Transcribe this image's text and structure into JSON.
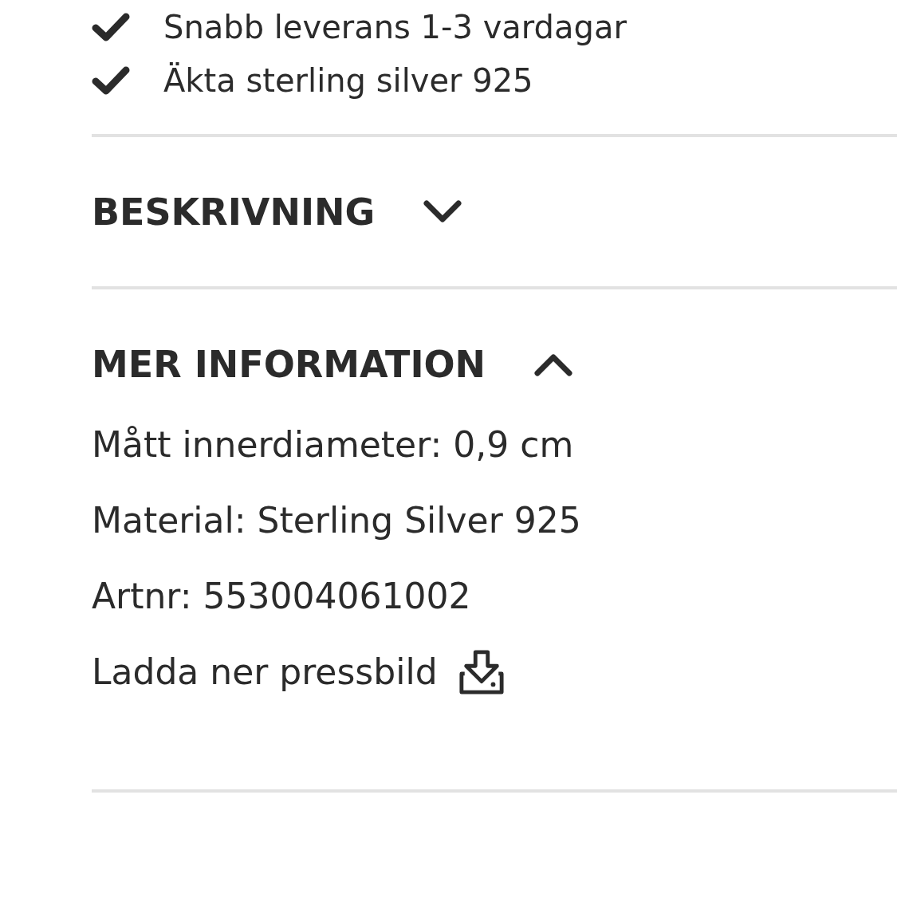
{
  "usps": [
    {
      "text": "Snabb leverans 1-3 vardagar"
    },
    {
      "text": "Äkta sterling silver 925"
    }
  ],
  "sections": [
    {
      "title": "BESKRIVNING",
      "expanded": false
    },
    {
      "title": "MER INFORMATION",
      "expanded": true,
      "lines": [
        "Mått innerdiameter: 0,9 cm",
        "Material: Sterling Silver 925",
        "Artnr: 553004061002"
      ],
      "download_link": "Ladda ner pressbild"
    }
  ]
}
